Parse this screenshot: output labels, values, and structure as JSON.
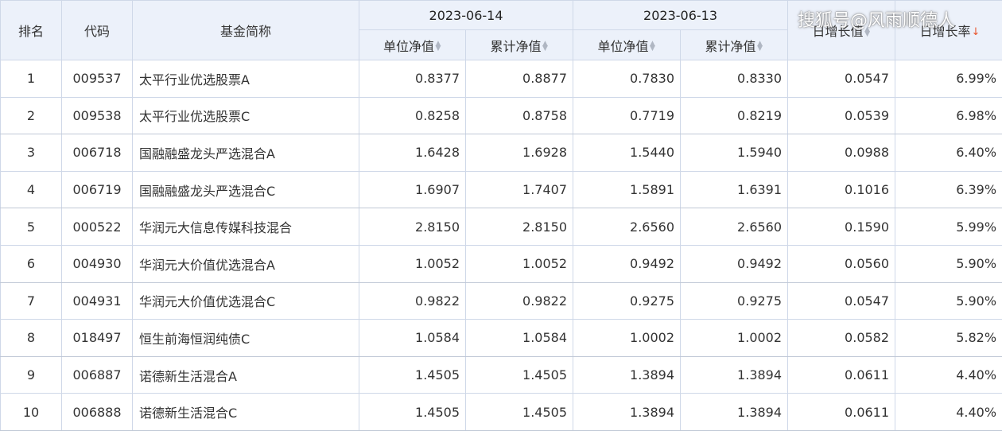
{
  "header": {
    "rank": "排名",
    "code": "代码",
    "name": "基金简称",
    "date1": "2023-06-14",
    "date2": "2023-06-13",
    "unit_nav": "单位净值",
    "acc_nav": "累计净值",
    "daily_growth_value": "日增长值",
    "daily_growth_rate": "日增长率"
  },
  "watermark": "搜狐号@风雨顺德人",
  "sort": {
    "active_column": "日增长率",
    "direction": "descending"
  },
  "colors": {
    "link": "#1f5ba8",
    "positive": "#cc0000",
    "header_bg": "#ecf1fa",
    "border": "#cfd8e8"
  },
  "rows": [
    {
      "rank": "1",
      "code": "009537",
      "name": "太平行业优选股票A",
      "nav1": "0.8377",
      "acc1": "0.8877",
      "nav2": "0.7830",
      "acc2": "0.8330",
      "growth": "0.0547",
      "rate": "6.99%"
    },
    {
      "rank": "2",
      "code": "009538",
      "name": "太平行业优选股票C",
      "nav1": "0.8258",
      "acc1": "0.8758",
      "nav2": "0.7719",
      "acc2": "0.8219",
      "growth": "0.0539",
      "rate": "6.98%"
    },
    {
      "rank": "3",
      "code": "006718",
      "name": "国融融盛龙头严选混合A",
      "nav1": "1.6428",
      "acc1": "1.6928",
      "nav2": "1.5440",
      "acc2": "1.5940",
      "growth": "0.0988",
      "rate": "6.40%"
    },
    {
      "rank": "4",
      "code": "006719",
      "name": "国融融盛龙头严选混合C",
      "nav1": "1.6907",
      "acc1": "1.7407",
      "nav2": "1.5891",
      "acc2": "1.6391",
      "growth": "0.1016",
      "rate": "6.39%"
    },
    {
      "rank": "5",
      "code": "000522",
      "name": "华润元大信息传媒科技混合",
      "nav1": "2.8150",
      "acc1": "2.8150",
      "nav2": "2.6560",
      "acc2": "2.6560",
      "growth": "0.1590",
      "rate": "5.99%"
    },
    {
      "rank": "6",
      "code": "004930",
      "name": "华润元大价值优选混合A",
      "nav1": "1.0052",
      "acc1": "1.0052",
      "nav2": "0.9492",
      "acc2": "0.9492",
      "growth": "0.0560",
      "rate": "5.90%"
    },
    {
      "rank": "7",
      "code": "004931",
      "name": "华润元大价值优选混合C",
      "nav1": "0.9822",
      "acc1": "0.9822",
      "nav2": "0.9275",
      "acc2": "0.9275",
      "growth": "0.0547",
      "rate": "5.90%"
    },
    {
      "rank": "8",
      "code": "018497",
      "name": "恒生前海恒润纯债C",
      "nav1": "1.0584",
      "acc1": "1.0584",
      "nav2": "1.0002",
      "acc2": "1.0002",
      "growth": "0.0582",
      "rate": "5.82%"
    },
    {
      "rank": "9",
      "code": "006887",
      "name": "诺德新生活混合A",
      "nav1": "1.4505",
      "acc1": "1.4505",
      "nav2": "1.3894",
      "acc2": "1.3894",
      "growth": "0.0611",
      "rate": "4.40%"
    },
    {
      "rank": "10",
      "code": "006888",
      "name": "诺德新生活混合C",
      "nav1": "1.4505",
      "acc1": "1.4505",
      "nav2": "1.3894",
      "acc2": "1.3894",
      "growth": "0.0611",
      "rate": "4.40%"
    }
  ]
}
